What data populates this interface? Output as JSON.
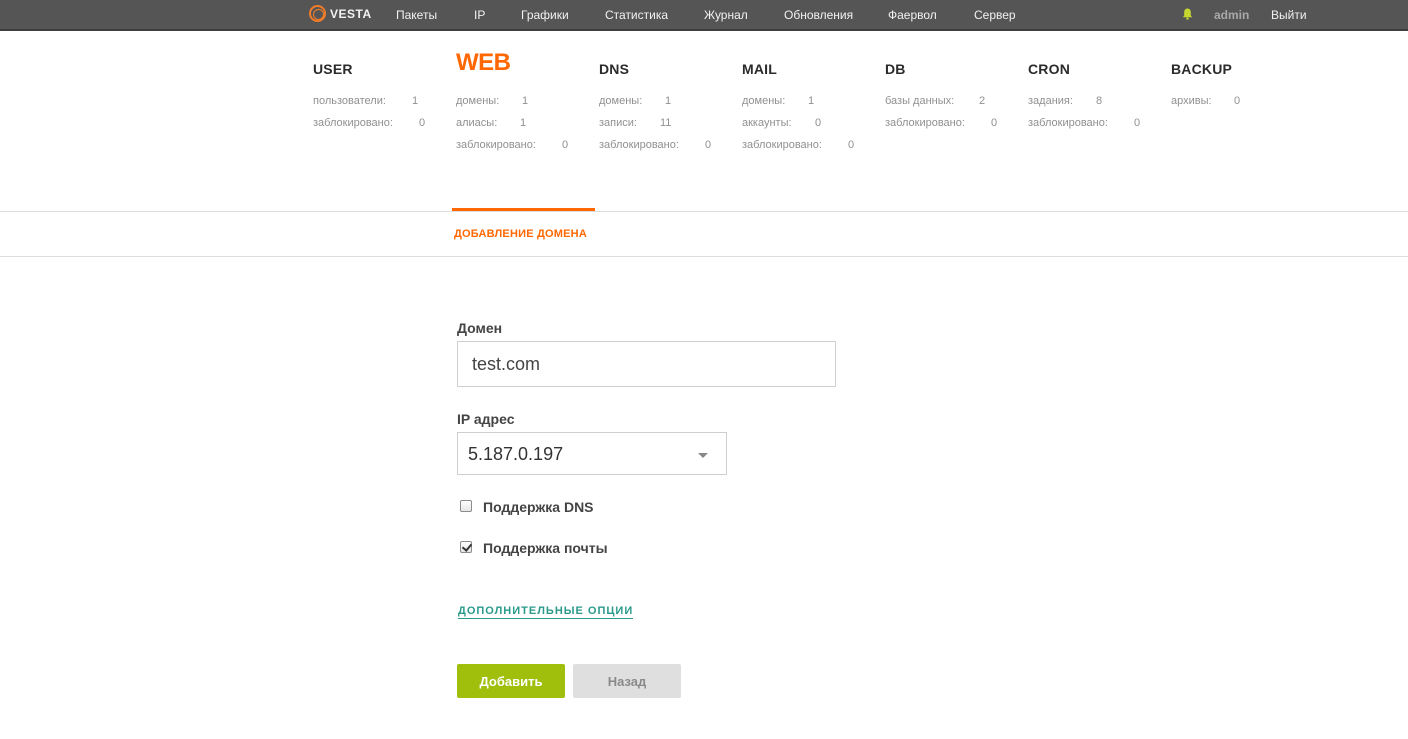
{
  "topbar": {
    "logo_text": "VESTA",
    "nav": [
      "Пакеты",
      "IP",
      "Графики",
      "Статистика",
      "Журнал",
      "Обновления",
      "Фаервол",
      "Сервер"
    ],
    "user": "admin",
    "logout": "Выйти",
    "accent_color": "#f07c2a",
    "bell_color": "#c5d62f"
  },
  "stats": [
    {
      "title": "USER",
      "rows": [
        {
          "label": "пользователи:",
          "value": "1"
        },
        {
          "label": "заблокировано:",
          "value": "0"
        }
      ]
    },
    {
      "title": "WEB",
      "rows": [
        {
          "label": "домены:",
          "value": "1"
        },
        {
          "label": "алиасы:",
          "value": "1"
        },
        {
          "label": "заблокировано:",
          "value": "0"
        }
      ]
    },
    {
      "title": "DNS",
      "rows": [
        {
          "label": "домены:",
          "value": "1"
        },
        {
          "label": "записи:",
          "value": "11"
        },
        {
          "label": "заблокировано:",
          "value": "0"
        }
      ]
    },
    {
      "title": "MAIL",
      "rows": [
        {
          "label": "домены:",
          "value": "1"
        },
        {
          "label": "аккаунты:",
          "value": "0"
        },
        {
          "label": "заблокировано:",
          "value": "0"
        }
      ]
    },
    {
      "title": "DB",
      "rows": [
        {
          "label": "базы данных:",
          "value": "2"
        },
        {
          "label": "заблокировано:",
          "value": "0"
        }
      ]
    },
    {
      "title": "CRON",
      "rows": [
        {
          "label": "задания:",
          "value": "8"
        },
        {
          "label": "заблокировано:",
          "value": "0"
        }
      ]
    },
    {
      "title": "BACKUP",
      "rows": [
        {
          "label": "архивы:",
          "value": "0"
        }
      ]
    }
  ],
  "active_tab": "WEB",
  "page_title": "ДОБАВЛЕНИЕ ДОМЕНА",
  "form": {
    "domain_label": "Домен",
    "domain_value": "test.com",
    "ip_label": "IP адрес",
    "ip_value": "5.187.0.197",
    "dns_label": "Поддержка DNS",
    "dns_checked": false,
    "mail_label": "Поддержка почты",
    "mail_checked": true,
    "more_options": "ДОПОЛНИТЕЛЬНЫЕ ОПЦИИ",
    "add_button": "Добавить",
    "back_button": "Назад"
  },
  "colors": {
    "active": "#ff6701",
    "primary_button": "#9fbf0c",
    "link": "#2a9a8b"
  }
}
